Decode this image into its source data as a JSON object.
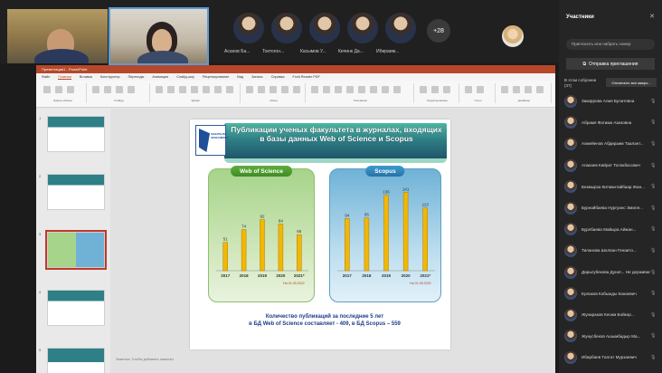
{
  "meeting": {
    "participants_strip": [
      {
        "label": "Асанов Ба..."
      },
      {
        "label": "Токтогон..."
      },
      {
        "label": "Касымов У..."
      },
      {
        "label": "Кичинк Да..."
      },
      {
        "label": "Ибираим..."
      }
    ],
    "more_count": "+28"
  },
  "panel": {
    "title": "Участники",
    "invite_placeholder": "Пригласить или набрать номер",
    "send_invites": "Отправка приглашения",
    "in_meeting": "В этом собрании (37)",
    "mute_all": "Отключить все микро...",
    "participants": [
      "Закиррова Алия Булатовна",
      "Абрамя Фатима Азизовна",
      "Ахмейенов Абдираим Таалант...",
      "Апакаев Кайрат Толокбасович",
      "Бекмырза Китмантайбаар Жан...",
      "Бурнайбаева Нургуанс Эмиля...",
      "Бурлбаева Майыра Айжан...",
      "Тиланова Шолпан Генаито...",
      "Дарыгубекова Дунат... Не держивая",
      "Ерлаков Кобыжды Канаевич",
      "Жунараков Кесим Бойкор...",
      "Жунусбеков Ашымбадыр Ма...",
      "Ибирбаев Талгат Мурзаевич",
      "Кабдыкемова Гюмар Дамел..."
    ]
  },
  "ppt": {
    "titlebar": "Презентация1 - PowerPoint",
    "tabs": [
      "Файл",
      "Главная",
      "Вставка",
      "Конструктор",
      "Переходы",
      "Анимация",
      "Слайд-шоу",
      "Рецензирование",
      "Вид",
      "Запись",
      "Справка",
      "Foxit Reader PDF"
    ],
    "active_tab_index": 1,
    "ribbon_groups": [
      "Буфер обмена",
      "Слайды",
      "Шрифт",
      "Абзац",
      "Рисование",
      "Редактирование",
      "Голос",
      "Дизайнер"
    ],
    "slide_numbers": [
      "1",
      "2",
      "3",
      "4",
      "5"
    ],
    "notes_placeholder": "Заметки: Чтобы добавить заметки"
  },
  "slide": {
    "title": "Публикации ученых факультета в журналах, входящих в базы данных Web of Science и Scopus",
    "logo_text": "ФАКУЛЬТЕТ ЭКОНОМИКИ",
    "summary_line1": "Количество публикаций за последние 5 лет",
    "summary_line2": "в БД Web of Science составляет - 409, в БД Scopus – 559",
    "note": "На 01.05.2022"
  },
  "chart_data": [
    {
      "type": "bar",
      "title": "Web of Science",
      "categories": [
        "2017",
        "2018",
        "2019",
        "2020",
        "2021*"
      ],
      "values": [
        51,
        74,
        92,
        84,
        65
      ],
      "ylim": [
        0,
        150
      ],
      "color": "#f2b705"
    },
    {
      "type": "bar",
      "title": "Scopus",
      "categories": [
        "2017",
        "2018",
        "2019",
        "2020",
        "2021*"
      ],
      "values": [
        94,
        95,
        136,
        141,
        113
      ],
      "ylim": [
        0,
        150
      ],
      "color": "#f2b705"
    }
  ]
}
